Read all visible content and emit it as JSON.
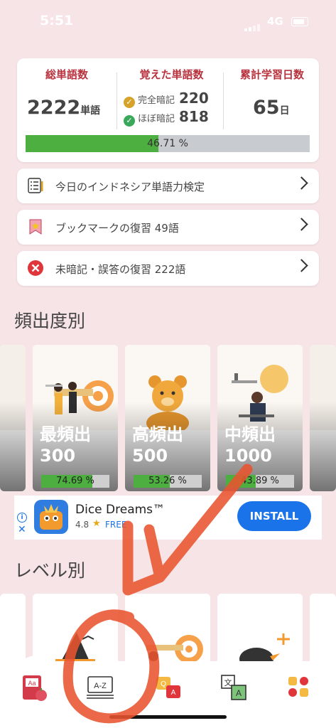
{
  "status_bar": {
    "time": "5:51",
    "network": "4G"
  },
  "stats": {
    "total_words": {
      "label": "総単語数",
      "value": "2222",
      "unit": "単語"
    },
    "learned": {
      "label": "覚えた単語数",
      "complete_label": "完全暗記",
      "complete_value": "220",
      "almost_label": "ほぼ暗記",
      "almost_value": "818"
    },
    "study_days": {
      "label": "累計学習日数",
      "value": "65",
      "unit": "日"
    },
    "progress_text": "46.71 %",
    "progress_value": 46.71
  },
  "menu": [
    {
      "label": "今日のインドネシア単語力検定",
      "icon": "checklist-icon"
    },
    {
      "label": "ブックマークの復習 49語",
      "icon": "bookmark-star-icon"
    },
    {
      "label": "未暗記・誤答の復習 222語",
      "icon": "red-x-icon"
    }
  ],
  "section_frequency": "頻出度別",
  "frequency_cards": [
    {
      "title": "最頻出",
      "count": "300",
      "progress_text": "74.69 %",
      "progress": 74.69
    },
    {
      "title": "高頻出",
      "count": "500",
      "progress_text": "53.26 %",
      "progress": 53.26
    },
    {
      "title": "中頻出",
      "count": "1000",
      "progress_text": "43.89 %",
      "progress": 43.89
    }
  ],
  "ad": {
    "app_name": "Dice Dreams™",
    "rating": "4.8",
    "price": "FREE",
    "install_label": "INSTALL"
  },
  "section_level": "レベル別",
  "bottom_nav": [
    {
      "icon": "flashcard-book-icon"
    },
    {
      "icon": "a-to-z-dictionary-icon"
    },
    {
      "icon": "quiz-bubble-icon"
    },
    {
      "icon": "translate-icon"
    },
    {
      "icon": "grid-menu-icon"
    }
  ],
  "colors": {
    "accent_red": "#b8323e",
    "progress_green": "#4caf3f",
    "install_blue": "#1a73e8",
    "annotation": "#e8542f"
  }
}
